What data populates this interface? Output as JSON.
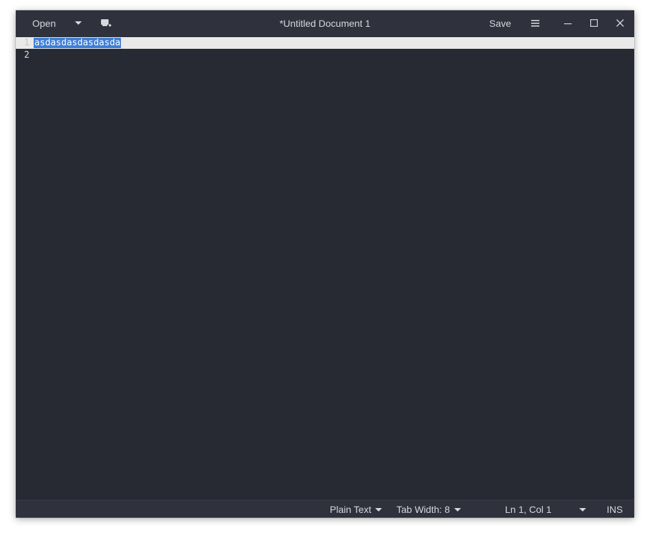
{
  "header": {
    "open_label": "Open",
    "title": "*Untitled Document 1",
    "save_label": "Save"
  },
  "editor": {
    "lines": [
      {
        "number": "1",
        "text": "asdasdasdasdasda",
        "selected": true
      },
      {
        "number": "2",
        "text": "",
        "selected": false
      }
    ]
  },
  "statusbar": {
    "language": "Plain Text",
    "tab_width": "Tab Width: 8",
    "position": "Ln 1, Col 1",
    "mode": "INS"
  },
  "colors": {
    "background": "#282a33",
    "headerbar": "#2f313c",
    "text": "#d7d9de",
    "selection": "#3d7ed6",
    "current_line": "#e9e9e9"
  },
  "icons": {
    "open_dropdown": "chevron-down-icon",
    "new_document": "new-document-icon",
    "menu": "hamburger-menu-icon",
    "minimize": "minimize-icon",
    "maximize": "maximize-icon",
    "close": "close-icon"
  }
}
